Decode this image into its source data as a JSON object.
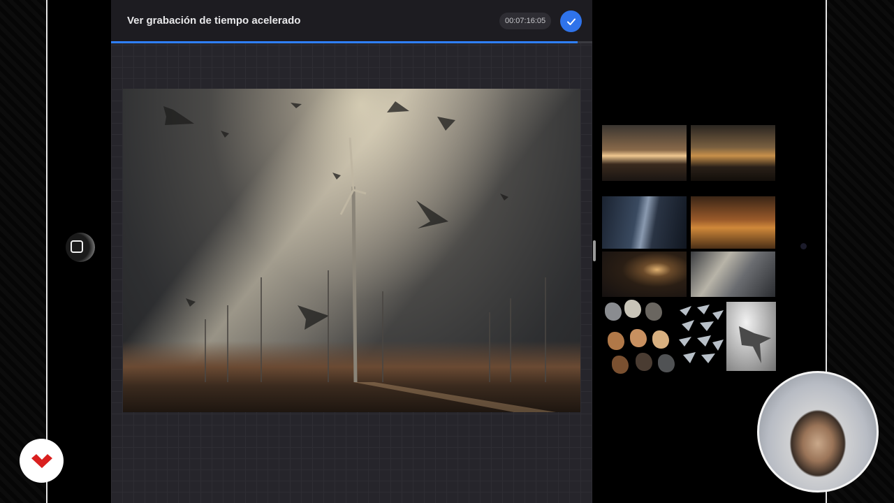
{
  "header": {
    "title": "Ver grabación de tiempo acelerado",
    "timecode": "00:07:16:05"
  },
  "playback": {
    "progress_fraction": 0.97
  },
  "colors": {
    "accent": "#2f73ea",
    "progress": "#2f80ff",
    "panel_bg": "#26252b",
    "header_bg": "#1d1c21"
  },
  "icons": {
    "done": "checkmark-icon",
    "sidebar": "square-icon",
    "logo": "brand-logo-icon"
  }
}
